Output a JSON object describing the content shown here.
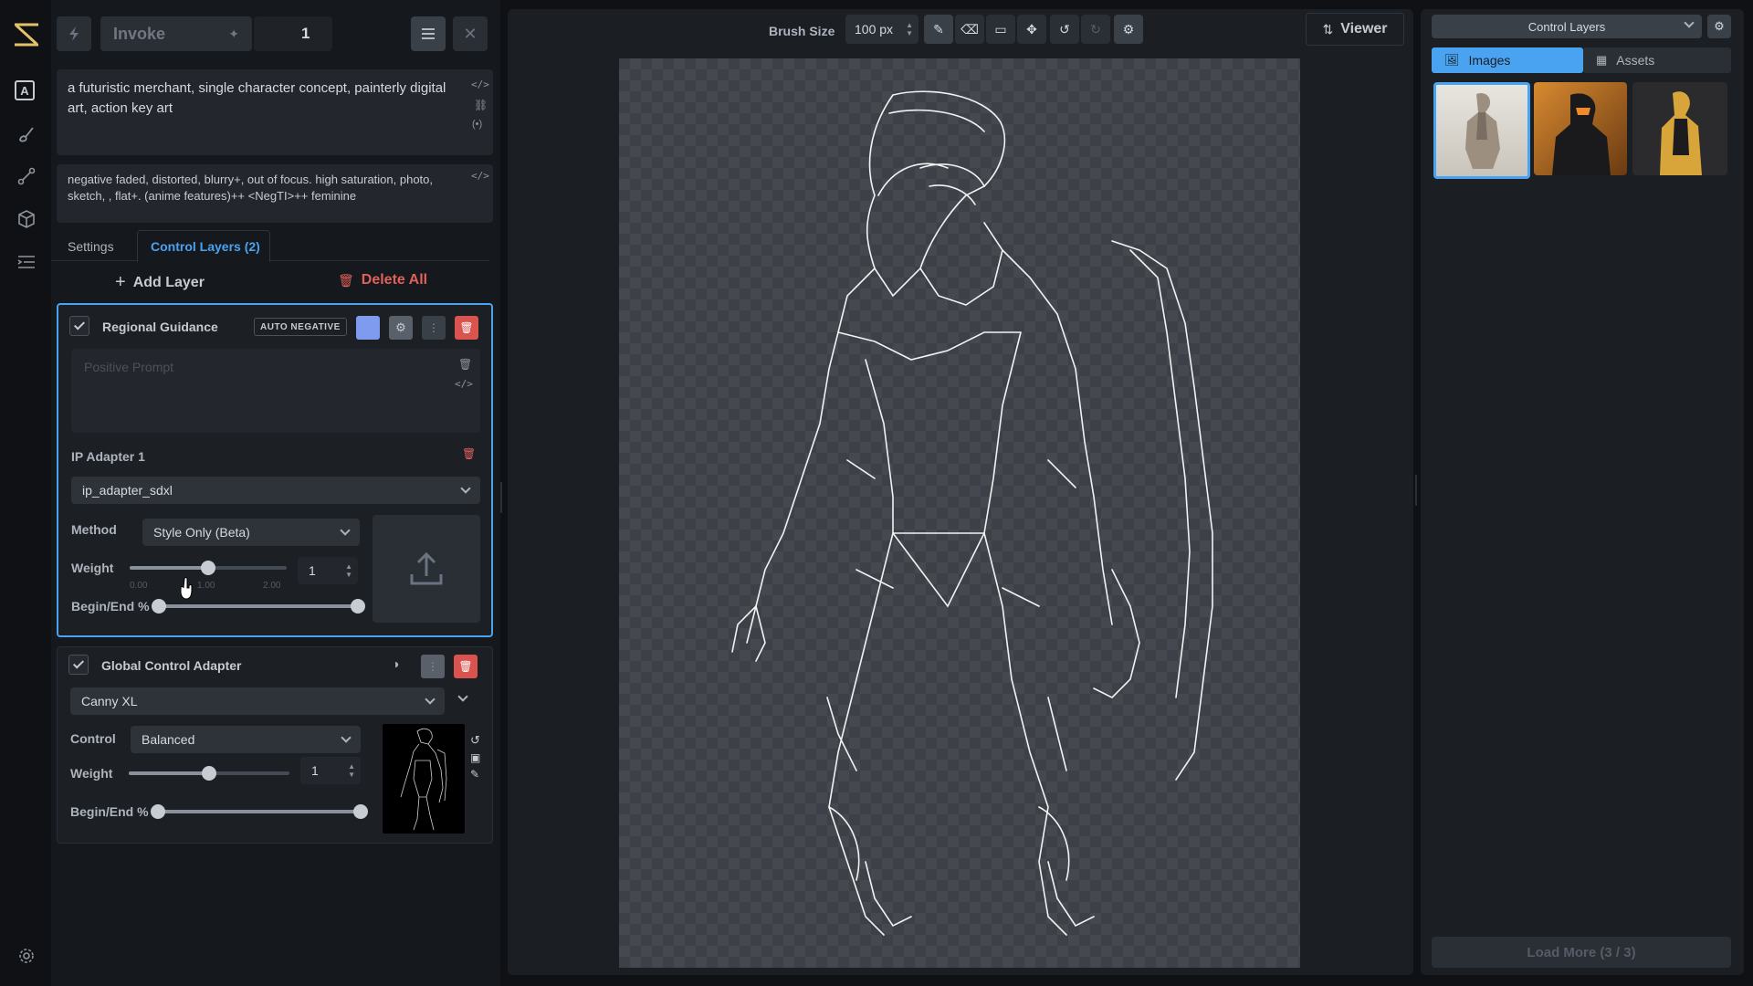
{
  "colors": {
    "accent": "#4aa3f0",
    "danger": "#d9534f",
    "brand": "#e3c26a"
  },
  "sidebar": {
    "icons": [
      "text-icon",
      "brush-icon",
      "workflow-icon",
      "cube-icon",
      "queue-icon",
      "settings-icon"
    ]
  },
  "topbar": {
    "invoke_label": "Invoke",
    "iterations": "1"
  },
  "prompts": {
    "positive": "a futuristic merchant, single character concept, painterly digital art, action key art",
    "negative": "negative faded, distorted, blurry+, out of focus. high saturation, photo, sketch, , flat+. (anime features)++ <NegTI>++ feminine"
  },
  "tabs": {
    "settings": "Settings",
    "control_layers": "Control Layers (2)"
  },
  "layer_actions": {
    "add": "Add Layer",
    "delete_all": "Delete All"
  },
  "regional": {
    "title": "Regional Guidance",
    "auto_negative": "AUTO NEGATIVE",
    "swatch_color": "#7e9bf0",
    "prompt_placeholder": "Positive Prompt",
    "ip_adapter_title": "IP Adapter 1",
    "model": "ip_adapter_sdxl",
    "method_label": "Method",
    "method_value": "Style Only (Beta)",
    "weight_label": "Weight",
    "weight_value": "1",
    "weight_min": "0.00",
    "weight_mid": "1.00",
    "weight_max": "2.00",
    "weight_fraction": 0.5,
    "begin_end_label": "Begin/End %",
    "begin": 0.0,
    "end": 1.0
  },
  "global": {
    "title": "Global Control Adapter",
    "model": "Canny XL",
    "control_label": "Control",
    "control_value": "Balanced",
    "weight_label": "Weight",
    "weight_value": "1",
    "weight_fraction": 0.5,
    "begin_end_label": "Begin/End %",
    "begin": 0.0,
    "end": 1.0
  },
  "canvas_toolbar": {
    "brush_size_label": "Brush Size",
    "brush_size_value": "100 px",
    "viewer_label": "Viewer"
  },
  "gallery": {
    "board_select": "Control Layers",
    "tab_images": "Images",
    "tab_assets": "Assets",
    "load_more": "Load More (3 / 3)"
  }
}
